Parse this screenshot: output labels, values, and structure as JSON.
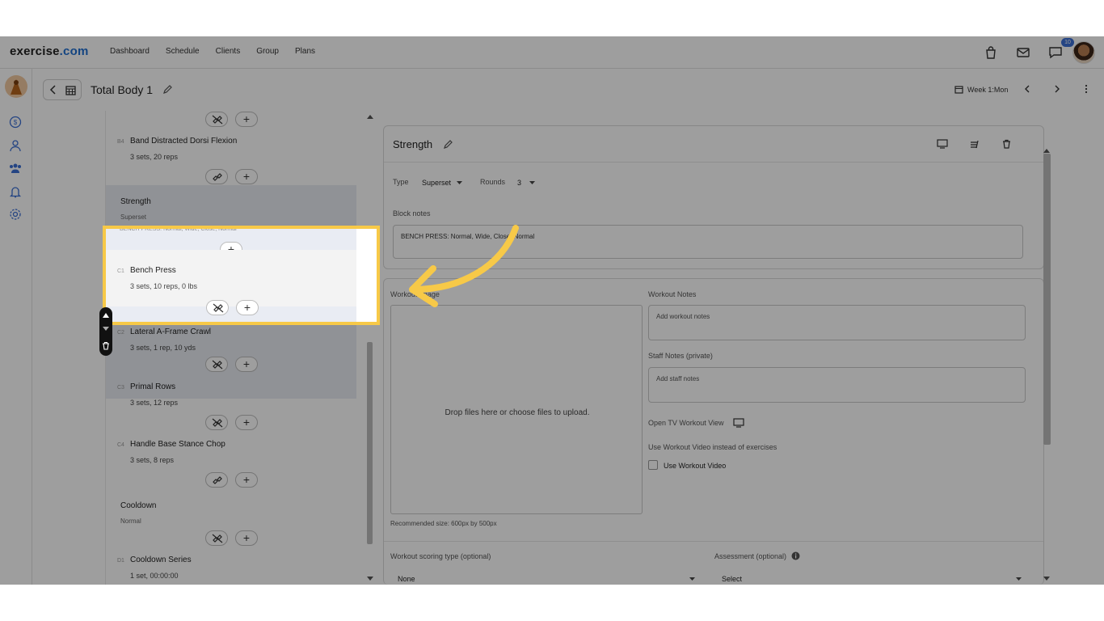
{
  "nav": {
    "logo_main": "exercise",
    "logo_suffix": ".com",
    "links": [
      "Dashboard",
      "Schedule",
      "Clients",
      "Group",
      "Plans"
    ],
    "message_badge": "10"
  },
  "header": {
    "title": "Total Body 1",
    "week": "Week 1:Mon"
  },
  "list": {
    "b4": {
      "code": "B4",
      "name": "Band Distracted Dorsi Flexion",
      "detail": "3 sets, 20 reps"
    },
    "strength_block": {
      "name": "Strength",
      "type": "Superset",
      "notes_preview": "BENCH PRESS: Normal, Wide, Close, Normal"
    },
    "c1": {
      "code": "C1",
      "name": "Bench Press",
      "detail": "3 sets, 10 reps, 0 lbs"
    },
    "c2": {
      "code": "C2",
      "name": "Lateral A-Frame Crawl",
      "detail": "3 sets, 1 rep, 10 yds"
    },
    "c3": {
      "code": "C3",
      "name": "Primal Rows",
      "detail": "3 sets, 12 reps"
    },
    "c4": {
      "code": "C4",
      "name": "Handle Base Stance Chop",
      "detail": "3 sets, 8 reps"
    },
    "cooldown_block": {
      "name": "Cooldown",
      "type": "Normal"
    },
    "d1": {
      "code": "D1",
      "name": "Cooldown Series",
      "detail": "1 set, 00:00:00"
    }
  },
  "block": {
    "title": "Strength",
    "type_label": "Type",
    "type_value": "Superset",
    "rounds_label": "Rounds",
    "rounds_value": "3",
    "notes_label": "Block notes",
    "notes_value": "BENCH PRESS: Normal, Wide, Close, Normal"
  },
  "workout": {
    "image_label": "Workout Image",
    "drop_text": "Drop files here or choose files to upload.",
    "recommended": "Recommended size: 600px by 500px",
    "notes_label": "Workout Notes",
    "notes_placeholder": "Add workout notes",
    "staff_label": "Staff Notes (private)",
    "staff_placeholder": "Add staff notes",
    "tv_label": "Open TV Workout View",
    "video_question": "Use Workout Video instead of exercises",
    "video_checkbox": "Use Workout Video",
    "scoring_label": "Workout scoring type (optional)",
    "scoring_value": "None",
    "assessment_label": "Assessment (optional)",
    "assessment_value": "Select"
  },
  "colors": {
    "highlight": "#f7c948",
    "accent": "#1f6fd1",
    "badge": "#3b6fd4"
  }
}
